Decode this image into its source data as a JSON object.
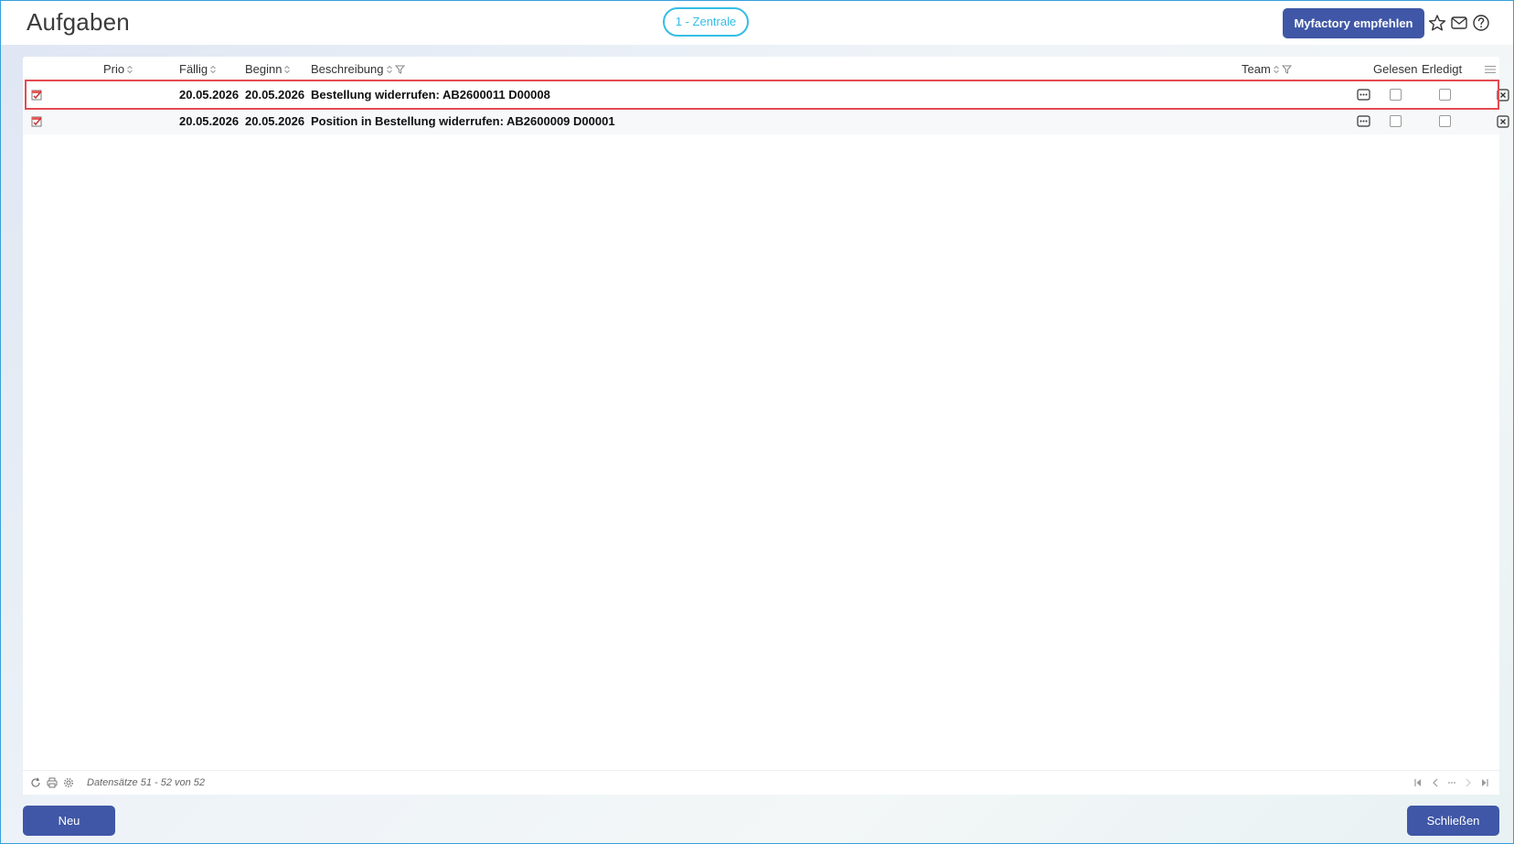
{
  "header": {
    "title": "Aufgaben",
    "site": "1 - Zentrale",
    "recommend_label": "Myfactory empfehlen",
    "icons": [
      "star-icon",
      "mail-icon",
      "help-icon"
    ]
  },
  "table": {
    "columns": {
      "prio": "Prio",
      "faellig": "Fällig",
      "beginn": "Beginn",
      "beschreibung": "Beschreibung",
      "team": "Team",
      "gelesen": "Gelesen",
      "erledigt": "Erledigt"
    },
    "rows": [
      {
        "faellig": "20.05.2026",
        "beginn": "20.05.2026",
        "beschreibung": "Bestellung widerrufen: AB2600011 D00008",
        "gelesen": false,
        "erledigt": false
      },
      {
        "faellig": "20.05.2026",
        "beginn": "20.05.2026",
        "beschreibung": "Position in Bestellung widerrufen: AB2600009 D00001",
        "gelesen": false,
        "erledigt": false
      }
    ]
  },
  "footer": {
    "records_text": "Datensätze 51 - 52 von 52"
  },
  "buttons": {
    "new_label": "Neu",
    "close_label": "Schließen"
  },
  "colors": {
    "primary": "#3f57a6",
    "accent": "#35bde6",
    "highlight": "#e44a52"
  }
}
